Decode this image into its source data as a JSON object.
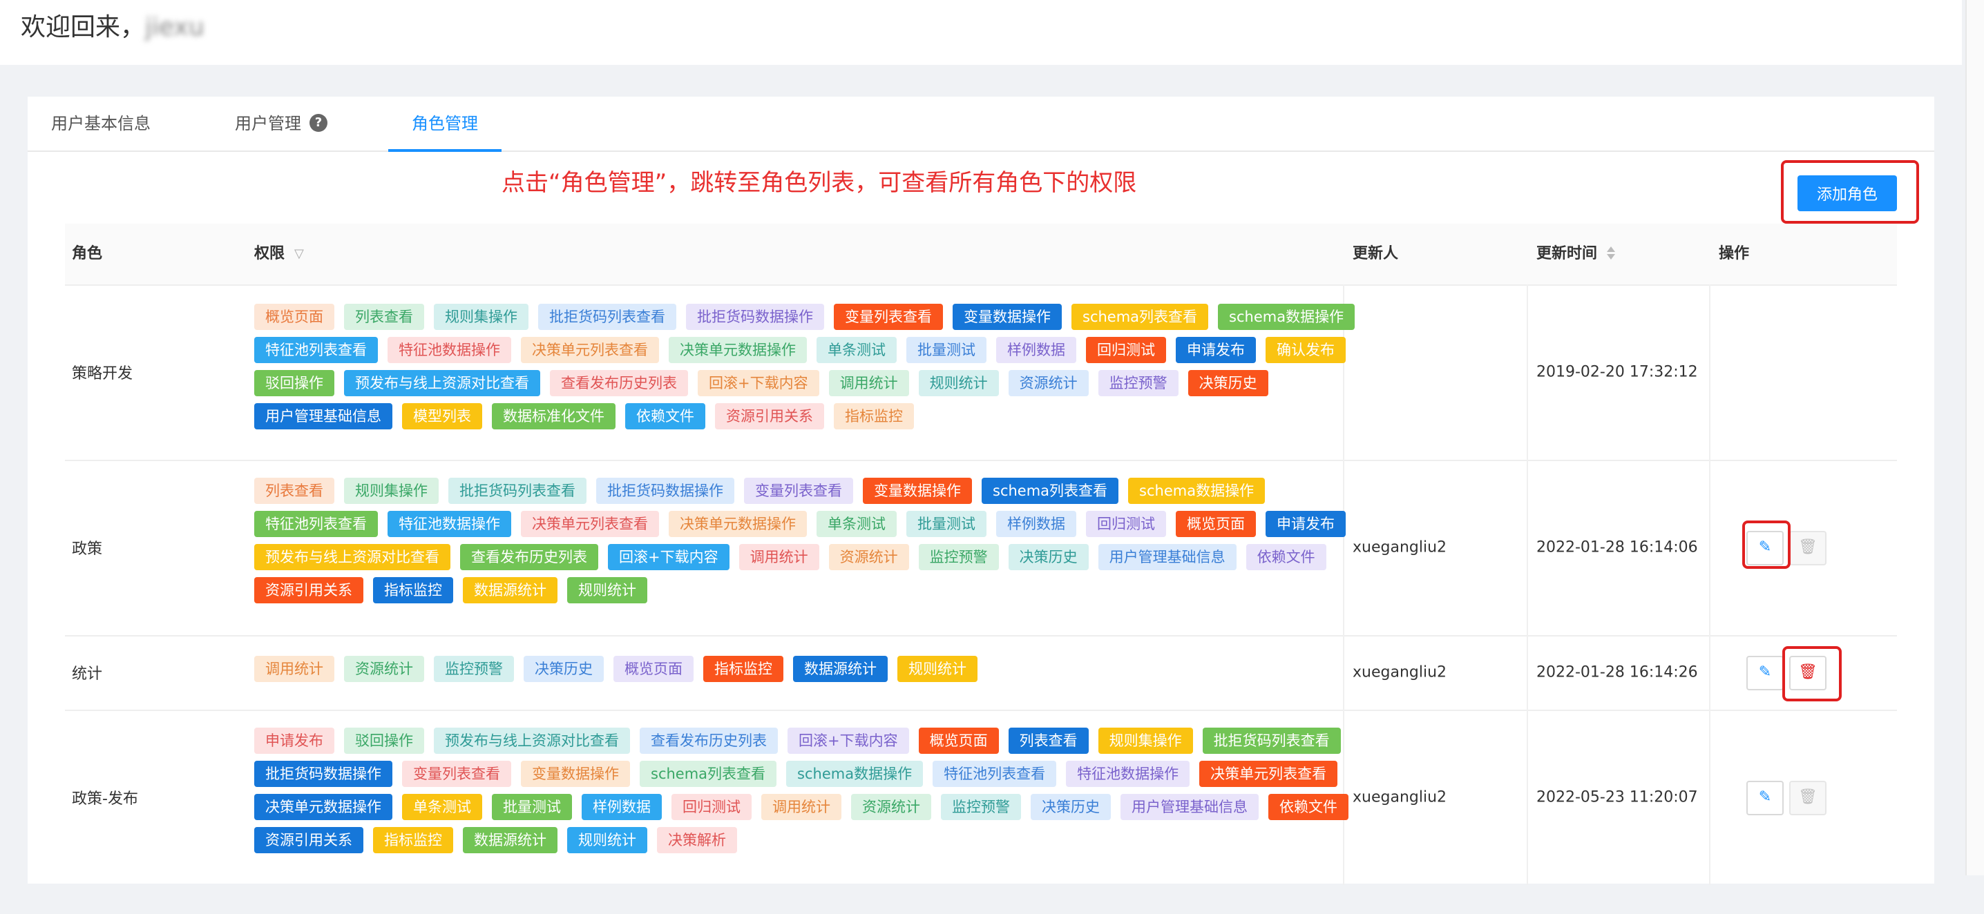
{
  "header": {
    "welcome": "欢迎回来，",
    "username": "jiexu"
  },
  "tabs": [
    {
      "label": "用户基本信息"
    },
    {
      "label": "用户管理"
    },
    {
      "label": "角色管理"
    }
  ],
  "annotation": "点击“角色管理”，跳转至角色列表，可查看所有角色下的权限",
  "toolbar": {
    "add_role_label": "添加角色"
  },
  "table": {
    "headers": {
      "role": "角色",
      "permissions": "权限",
      "updater": "更新人",
      "updated_at": "更新时间",
      "ops": "操作"
    },
    "rows": [
      {
        "role": "策略开发",
        "updater": "",
        "updated_at": "2019-02-20 17:32:12",
        "permissions": [
          "概览页面",
          "列表查看",
          "规则集操作",
          "批拒货码列表查看",
          "批拒货码数据操作",
          "变量列表查看",
          "变量数据操作",
          "schema列表查看",
          "schema数据操作",
          "特征池列表查看",
          "特征池数据操作",
          "决策单元列表查看",
          "决策单元数据操作",
          "单条测试",
          "批量测试",
          "样例数据",
          "回归测试",
          "申请发布",
          "确认发布",
          "驳回操作",
          "预发布与线上资源对比查看",
          "查看发布历史列表",
          "回滚+下载内容",
          "调用统计",
          "规则统计",
          "资源统计",
          "监控预警",
          "决策历史",
          "用户管理基础信息",
          "模型列表",
          "数据标准化文件",
          "依赖文件",
          "资源引用关系",
          "指标监控"
        ]
      },
      {
        "role": "政策",
        "updater": "xuegangliu2",
        "updated_at": "2022-01-28 16:14:06",
        "permissions": [
          "列表查看",
          "规则集操作",
          "批拒货码列表查看",
          "批拒货码数据操作",
          "变量列表查看",
          "变量数据操作",
          "schema列表查看",
          "schema数据操作",
          "特征池列表查看",
          "特征池数据操作",
          "决策单元列表查看",
          "决策单元数据操作",
          "单条测试",
          "批量测试",
          "样例数据",
          "回归测试",
          "概览页面",
          "申请发布",
          "预发布与线上资源对比查看",
          "查看发布历史列表",
          "回滚+下载内容",
          "调用统计",
          "资源统计",
          "监控预警",
          "决策历史",
          "用户管理基础信息",
          "依赖文件",
          "资源引用关系",
          "指标监控",
          "数据源统计",
          "规则统计"
        ]
      },
      {
        "role": "统计",
        "updater": "xuegangliu2",
        "updated_at": "2022-01-28 16:14:26",
        "permissions": [
          "调用统计",
          "资源统计",
          "监控预警",
          "决策历史",
          "概览页面",
          "指标监控",
          "数据源统计",
          "规则统计"
        ]
      },
      {
        "role": "政策-发布",
        "updater": "xuegangliu2",
        "updated_at": "2022-05-23 11:20:07",
        "permissions": [
          "申请发布",
          "驳回操作",
          "预发布与线上资源对比查看",
          "查看发布历史列表",
          "回滚+下载内容",
          "概览页面",
          "列表查看",
          "规则集操作",
          "批拒货码列表查看",
          "批拒货码数据操作",
          "变量列表查看",
          "变量数据操作",
          "schema列表查看",
          "schema数据操作",
          "特征池列表查看",
          "特征池数据操作",
          "决策单元列表查看",
          "决策单元数据操作",
          "单条测试",
          "批量测试",
          "样例数据",
          "回归测试",
          "调用统计",
          "资源统计",
          "监控预警",
          "决策历史",
          "用户管理基础信息",
          "依赖文件",
          "资源引用关系",
          "指标监控",
          "数据源统计",
          "规则统计",
          "决策解析"
        ]
      }
    ]
  },
  "tag_colors": {
    "light_orange": {
      "bg": "#fde6d6",
      "fg": "#e8793c"
    },
    "light_green": {
      "bg": "#d9f2e2",
      "fg": "#3aa766"
    },
    "light_teal": {
      "bg": "#d5f0ef",
      "fg": "#2f9b96"
    },
    "light_blue": {
      "bg": "#dbeafc",
      "fg": "#3a7fd6"
    },
    "light_purple": {
      "bg": "#e9e4fa",
      "fg": "#7a62cc"
    },
    "light_pink": {
      "bg": "#fde0e0",
      "fg": "#e05454"
    },
    "light_peach": {
      "bg": "#fde7d2",
      "fg": "#e5853b"
    },
    "solid_orange": {
      "bg": "#fa541c",
      "fg": "#ffffff"
    },
    "solid_blue": {
      "bg": "#1677d9",
      "fg": "#ffffff"
    },
    "solid_yellow": {
      "bg": "#fac311",
      "fg": "#ffffff"
    },
    "solid_green": {
      "bg": "#72c455",
      "fg": "#ffffff"
    },
    "solid_sky": {
      "bg": "#2fa8f0",
      "fg": "#ffffff"
    }
  },
  "row_tag_styles": [
    [
      "light_orange",
      "light_green",
      "light_teal",
      "light_blue",
      "light_purple",
      "solid_orange",
      "solid_blue",
      "solid_yellow",
      "solid_green",
      "solid_sky",
      "light_pink",
      "light_peach",
      "light_green",
      "light_teal",
      "light_blue",
      "light_purple",
      "solid_orange",
      "solid_blue",
      "solid_yellow",
      "solid_green",
      "solid_sky",
      "light_pink",
      "light_peach",
      "light_green",
      "light_teal",
      "light_blue",
      "light_purple",
      "solid_orange",
      "solid_blue",
      "solid_yellow",
      "solid_green",
      "solid_sky",
      "light_pink",
      "light_peach"
    ],
    [
      "light_orange",
      "light_green",
      "light_teal",
      "light_blue",
      "light_purple",
      "solid_orange",
      "solid_blue",
      "solid_yellow",
      "solid_green",
      "solid_sky",
      "light_pink",
      "light_peach",
      "light_green",
      "light_teal",
      "light_blue",
      "light_purple",
      "solid_orange",
      "solid_blue",
      "solid_yellow",
      "solid_green",
      "solid_sky",
      "light_pink",
      "light_peach",
      "light_green",
      "light_teal",
      "light_blue",
      "light_purple",
      "solid_orange",
      "solid_blue",
      "solid_yellow",
      "solid_green"
    ],
    [
      "light_peach",
      "light_green",
      "light_teal",
      "light_blue",
      "light_purple",
      "solid_orange",
      "solid_blue",
      "solid_yellow"
    ],
    [
      "light_pink",
      "light_green",
      "light_teal",
      "light_blue",
      "light_purple",
      "solid_orange",
      "solid_blue",
      "solid_yellow",
      "solid_green",
      "solid_blue",
      "light_pink",
      "light_peach",
      "light_green",
      "light_teal",
      "light_blue",
      "light_purple",
      "solid_orange",
      "solid_blue",
      "solid_yellow",
      "solid_green",
      "solid_sky",
      "light_pink",
      "light_peach",
      "light_green",
      "light_teal",
      "light_blue",
      "light_purple",
      "solid_orange",
      "solid_blue",
      "solid_yellow",
      "solid_green",
      "solid_sky",
      "light_pink"
    ]
  ],
  "icons": {
    "help": "?",
    "filter": "▽",
    "edit": "✎",
    "delete": "🗑"
  }
}
